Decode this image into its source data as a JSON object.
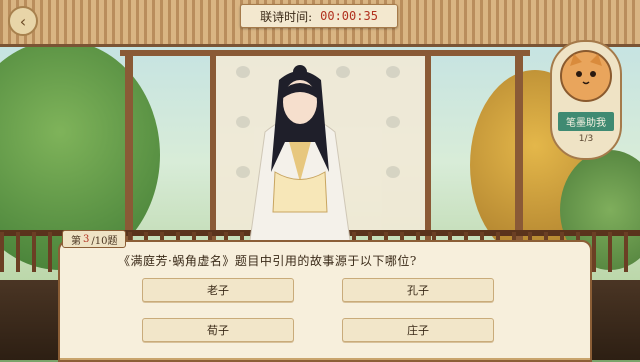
{
  "timer": {
    "label": "联诗时间:",
    "value": "00:00:35"
  },
  "helper": {
    "label": "笔墨助我",
    "count": "1/3"
  },
  "question": {
    "progress_prefix": "第",
    "current": "3",
    "total": "/10题",
    "text": "《满庭芳·蜗角虚名》题目中引用的故事源于以下哪位?",
    "options": [
      "老子",
      "孔子",
      "荀子",
      "庄子"
    ]
  },
  "colors": {
    "accent": "#b1311f",
    "panel": "#f7efdc",
    "wood": "#8b5e36",
    "helper_label": "#3f8a72"
  },
  "icons": {
    "back": "back-arrow-icon",
    "helper": "cat-avatar-icon"
  }
}
